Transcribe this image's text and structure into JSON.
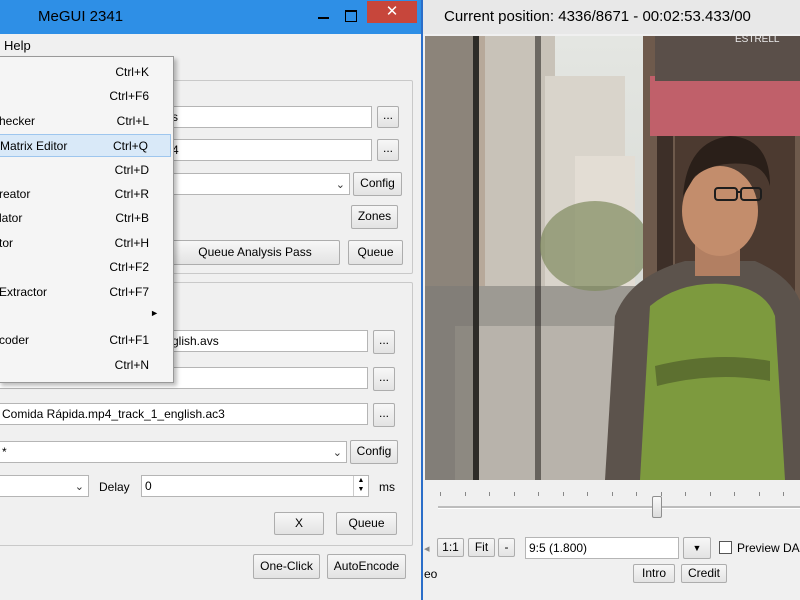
{
  "window": {
    "title": "MeGUI 2341",
    "close_glyph": "✕",
    "menu": {
      "help": "Help"
    }
  },
  "tools_menu": {
    "items": [
      {
        "label": "",
        "shortcut": "Ctrl+K"
      },
      {
        "label": "",
        "shortcut": "Ctrl+F6"
      },
      {
        "label": "hecker",
        "shortcut": "Ctrl+L"
      },
      {
        "label": "Matrix Editor",
        "shortcut": "Ctrl+Q",
        "highlighted": true
      },
      {
        "label": "",
        "shortcut": "Ctrl+D"
      },
      {
        "label": "reator",
        "shortcut": "Ctrl+R"
      },
      {
        "label": "lator",
        "shortcut": "Ctrl+B"
      },
      {
        "label": "tor",
        "shortcut": "Ctrl+H"
      },
      {
        "label": "",
        "shortcut": "Ctrl+F2"
      },
      {
        "label": "Extractor",
        "shortcut": "Ctrl+F7"
      },
      {
        "label": "",
        "shortcut": "",
        "submenu": "►"
      },
      {
        "label": "coder",
        "shortcut": "Ctrl+F1"
      },
      {
        "label": "",
        "shortcut": "Ctrl+N"
      }
    ]
  },
  "video_section": {
    "input_fragment": "s",
    "output_fragment": "4",
    "browse_label": "...",
    "config_label": "Config",
    "zones_label": "Zones",
    "queue_analysis_label": "Queue Analysis Pass",
    "queue_label": "Queue"
  },
  "audio_section": {
    "input_fragment": "glish.avs",
    "output_value": "Comida Rápida.mp4_track_1_english.ac3",
    "codec_fragment": "*",
    "browse_label": "...",
    "config_label": "Config",
    "delay_label": "Delay",
    "delay_value": "0",
    "delay_unit": "ms",
    "x_label": "X",
    "queue_label": "Queue"
  },
  "bottom_bar": {
    "oneclick_label": "One-Click",
    "autoencode_label": "AutoEncode"
  },
  "preview": {
    "position_text": "Current position: 4336/8671   -   00:02:53.433/00",
    "zoom_1to1": "1:1",
    "zoom_fit": "Fit",
    "zoom_minus": "-",
    "ar_value": "9:5 (1.800)",
    "preview_dar_label": "Preview DA",
    "left_fragment": "eo",
    "intro_label": "Intro",
    "credit_label": "Credit",
    "seek_position": 0.5,
    "sign_text": "ESTRELL"
  }
}
